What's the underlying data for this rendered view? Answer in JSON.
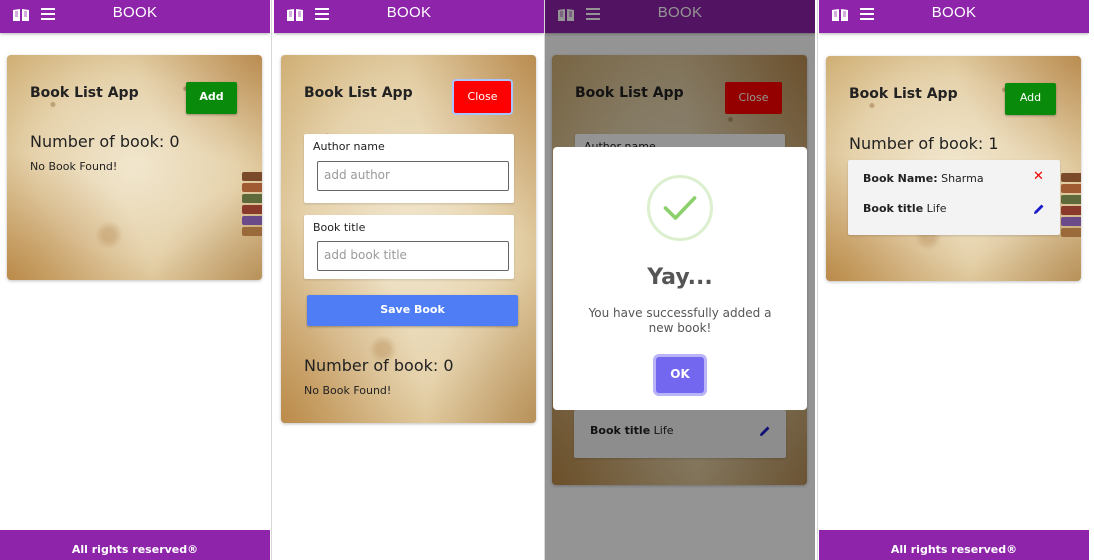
{
  "nav": {
    "brand": "BOOK",
    "book_icon": "open-book-icon",
    "menu_icon": "hamburger-menu-icon"
  },
  "footer": {
    "text": "All rights reserved®"
  },
  "app": {
    "title": "Book List App",
    "add_label": "Add",
    "close_label": "Close",
    "count_empty": "Number of book: 0",
    "count_one": "Number of book: 1",
    "no_book": "No Book Found!"
  },
  "form": {
    "author_label": "Author name",
    "author_placeholder": "add author",
    "title_label": "Book title",
    "title_placeholder": "add book title",
    "save_label": "Save Book"
  },
  "dialog": {
    "heading": "Yay...",
    "message": "You have successfully added a new book!",
    "ok_label": "OK",
    "partial_label": "Author name"
  },
  "book": {
    "name_label": "Book Name:",
    "name_value": "Sharma",
    "title_label": "Book title",
    "title_value": "Life"
  },
  "colors": {
    "header": "#8e24aa",
    "add": "#0a8a0a",
    "close": "#ff0000",
    "save": "#4f7df5",
    "ok": "#7367f0"
  }
}
